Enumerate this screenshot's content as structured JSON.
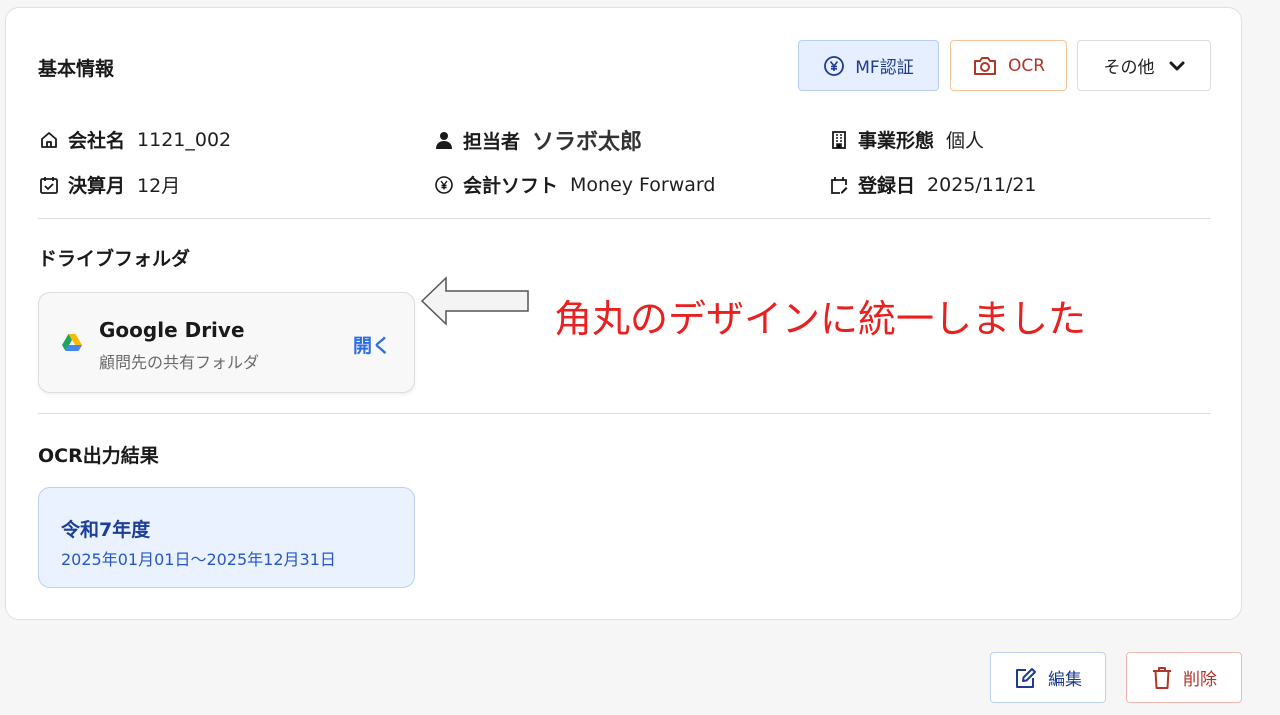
{
  "basic_info": {
    "title": "基本情報",
    "buttons": {
      "mf_label": "MF認証",
      "ocr_label": "OCR",
      "other_label": "その他"
    },
    "fields": {
      "company_label": "会社名",
      "company_value": "1121_002",
      "person_label": "担当者",
      "person_value": "ソラボ太郎",
      "business_type_label": "事業形態",
      "business_type_value": "個人",
      "fiscal_month_label": "決算月",
      "fiscal_month_value": "12月",
      "software_label": "会計ソフト",
      "software_value": "Money Forward",
      "registered_label": "登録日",
      "registered_value": "2025/11/21"
    }
  },
  "drive_folder": {
    "title": "ドライブフォルダ",
    "card": {
      "name": "Google Drive",
      "subtitle": "顧問先の共有フォルダ",
      "open_label": "開く"
    }
  },
  "annotation": {
    "text": "角丸のデザインに統一しました"
  },
  "ocr_results": {
    "title": "OCR出力結果",
    "card": {
      "year": "令和7年度",
      "range": "2025年01月01日〜2025年12月31日"
    }
  },
  "footer": {
    "edit_label": "編集",
    "delete_label": "削除"
  },
  "colors": {
    "accent_blue": "#2b6fe0",
    "mf_bg": "#e6efff",
    "ocr_red": "#b2352a",
    "annotation_red": "#e8201f"
  }
}
